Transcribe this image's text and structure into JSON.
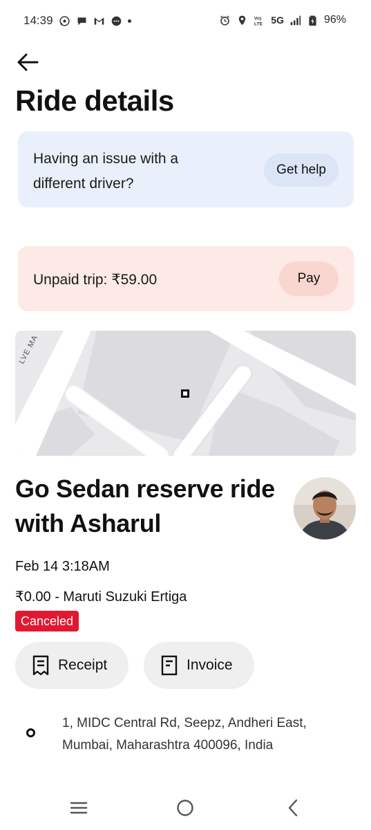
{
  "status_bar": {
    "time": "14:39",
    "left_icons": [
      "whatsapp-icon",
      "chat-icon",
      "gmail-icon",
      "message-icon",
      "dot-icon"
    ],
    "right_icons": [
      "alarm-icon",
      "location-icon",
      "volte-icon",
      "5g-icon",
      "signal-icon",
      "battery-icon"
    ],
    "network_label": "5G",
    "battery": "96%"
  },
  "header": {
    "back_icon": "arrow-left-icon",
    "title": "Ride details"
  },
  "help_card": {
    "text": "Having an issue with a different driver?",
    "button_label": "Get help",
    "bg_color": "#eaf0fb"
  },
  "unpaid_card": {
    "text": "Unpaid trip: ₹59.00",
    "button_label": "Pay",
    "bg_color": "#fde9e5"
  },
  "map": {
    "street_label": "LVE MA",
    "marker_icon": "location-marker-icon"
  },
  "ride": {
    "title": "Go Sedan reserve ride with Asharul",
    "date": "Feb 14 3:18AM",
    "price_vehicle": "₹0.00 - Maruti Suzuki Ertiga",
    "status": "Canceled",
    "status_color": "#e11930"
  },
  "actions": {
    "receipt_label": "Receipt",
    "invoice_label": "Invoice"
  },
  "pickup": {
    "address": "1, MIDC Central Rd, Seepz, Andheri East, Mumbai, Maharashtra 400096, India"
  },
  "nav_bar": {
    "icons": [
      "recents-icon",
      "home-icon",
      "back-icon"
    ]
  }
}
